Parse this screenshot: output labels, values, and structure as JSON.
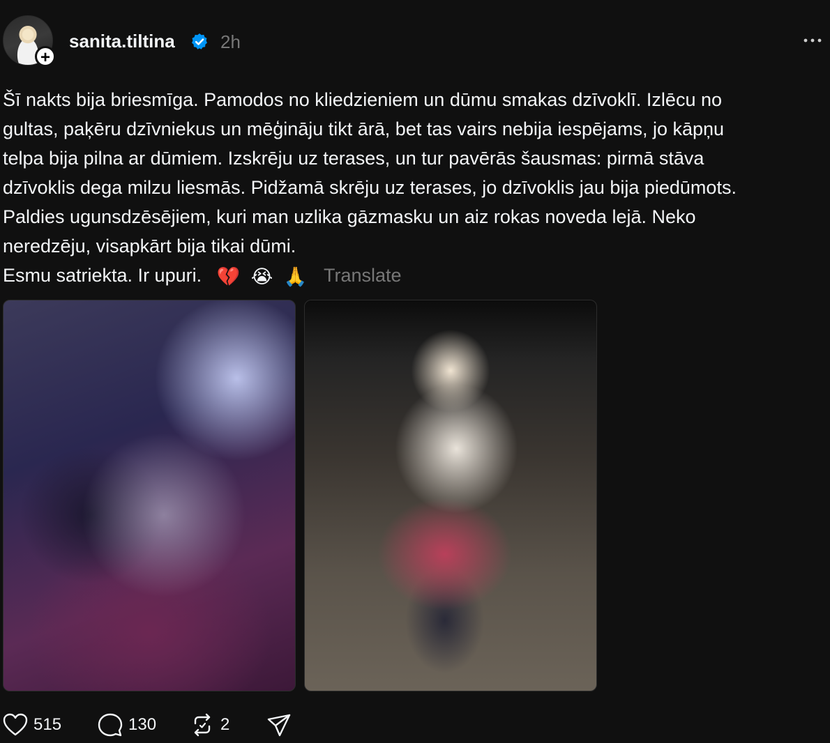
{
  "post": {
    "username": "sanita.tiltina",
    "verified": true,
    "timestamp": "2h",
    "caption_lines": [
      "Šī nakts bija briesmīga. Pamodos no kliedzieniem un dūmu smakas dzīvoklī. Izlēcu no",
      "gultas, paķēru dzīvniekus un mēģināju tikt ārā, bet tas vairs nebija iespējams, jo kāpņu",
      "telpa bija pilna ar dūmiem. Izskrēju uz terases, un tur pavērās šausmas: pirmā stāva",
      "dzīvoklis dega milzu liesmās. Pidžamā skrēju uz terases, jo dzīvoklis jau bija piedūmots.",
      "Paldies ugunsdzēsējiem, kuri man uzlika gāzmasku un aiz rokas noveda lejā. Neko",
      "neredzēju, visapkārt bija tikai dūmi."
    ],
    "last_line": "Esmu satriekta. Ir upuri.",
    "emojis": [
      "💔",
      "😭",
      "🙏"
    ],
    "translate_label": "Translate",
    "images": [
      {
        "name": "photo-dog-in-blanket"
      },
      {
        "name": "photo-woman-on-bench"
      }
    ],
    "actions": {
      "likes": "515",
      "replies": "130",
      "reposts": "2"
    }
  },
  "colors": {
    "background": "#101010",
    "text": "#f3f5f7",
    "muted": "#777777",
    "verified": "#0095f6"
  },
  "icons": [
    "plus-icon",
    "verified-badge-icon",
    "more-icon",
    "heart-icon",
    "comment-icon",
    "repost-icon",
    "share-icon"
  ]
}
